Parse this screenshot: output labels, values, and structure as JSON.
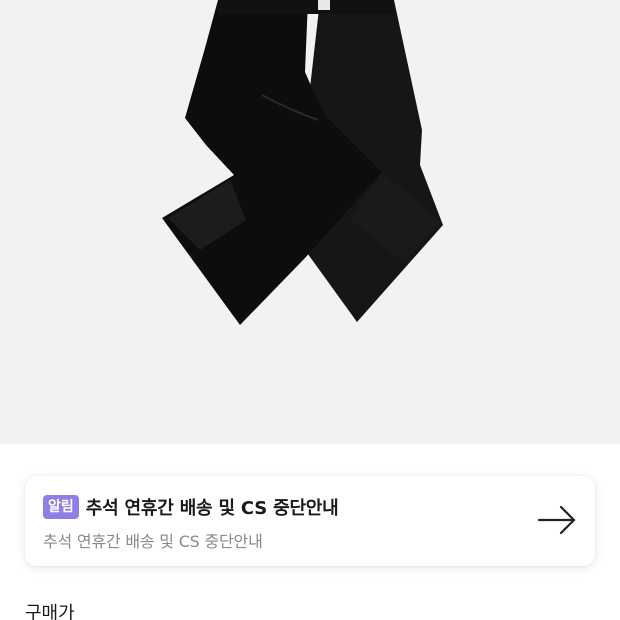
{
  "product_image": {
    "icon": "black-jeans-photo",
    "background_color": "#f2f2f2"
  },
  "notice": {
    "badge": "알림",
    "badge_color": "#8f7ee6",
    "title": "추석 연휴간 배송 및 CS 중단안내",
    "subtitle": "추석 연휴간 배송 및 CS 중단안내",
    "arrow_icon": "arrow-right-icon"
  },
  "price": {
    "label": "구매가"
  }
}
